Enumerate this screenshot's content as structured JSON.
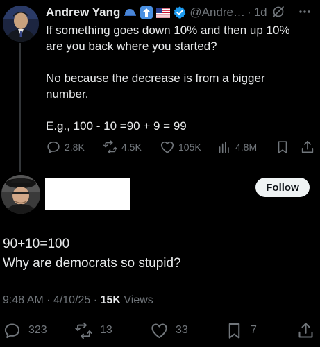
{
  "parent_tweet": {
    "author": {
      "name": "Andrew Yang",
      "name_emojis": [
        "blue-cap-icon",
        "up-arrow-emoji-icon",
        "us-flag-icon"
      ],
      "verified": true,
      "handle": "@Andre…",
      "dot": "·",
      "time": "1d"
    },
    "text": {
      "line1": "If something goes down 10% and then up 10% are you back where you started?",
      "line2": "No because the decrease is from a bigger number.",
      "line3": "E.g., 100 - 10 =90 + 9 = 99"
    },
    "actions": {
      "replies": "2.8K",
      "reposts": "4.5K",
      "likes": "105K",
      "views": "4.8M"
    }
  },
  "reply_tweet": {
    "follow_label": "Follow",
    "text": {
      "line1": "90+10=100",
      "line2": "Why are democrats so stupid?"
    },
    "meta": {
      "time": "9:48 AM",
      "sep1": "·",
      "date": "4/10/25",
      "sep2": "·",
      "views_count": "15K",
      "views_label": "Views"
    },
    "actions": {
      "replies": "323",
      "reposts": "13",
      "likes": "33",
      "bookmarks": "7"
    }
  },
  "colors": {
    "background": "#000000",
    "text_primary": "#e7e9ea",
    "text_secondary": "#71767b",
    "verified": "#1d9bf0",
    "follow_bg": "#eff3f4"
  }
}
